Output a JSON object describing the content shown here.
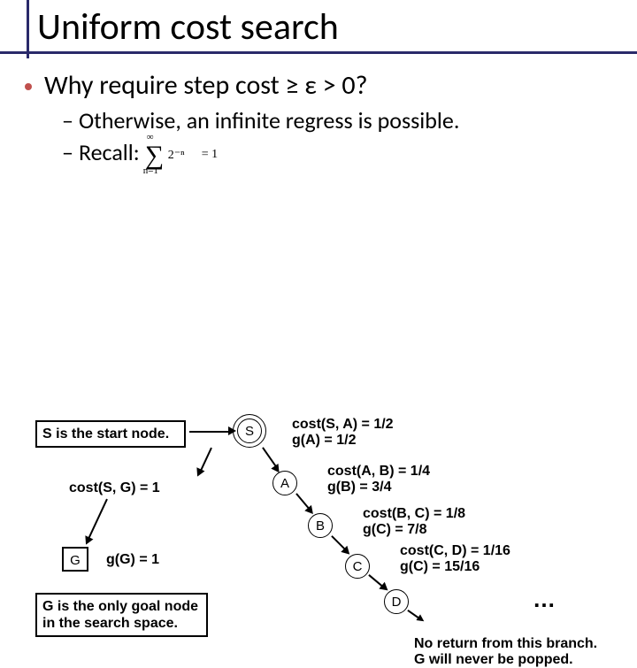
{
  "title": "Uniform cost search",
  "bullet1": "Why require step cost ≥ ε > 0?",
  "sub1": "Otherwise, an infinite regress is possible.",
  "sub2_prefix": "Recall:",
  "sigma": {
    "top": "∞",
    "bottom": "n=1",
    "term": "2⁻ⁿ",
    "rhs": "= 1"
  },
  "diagram": {
    "start_label": "S is the start node.",
    "cost_sg": "cost(S, G) = 1",
    "g_label": "g(G) = 1",
    "goal_label": "G is the only goal node in the search space.",
    "s": "S",
    "a": "A",
    "b": "B",
    "c": "C",
    "d": "D",
    "g": "G",
    "sa_cost": "cost(S, A) = 1/2",
    "ga_val": "g(A) = 1/2",
    "ab_cost": "cost(A, B) = 1/4",
    "gb_val": "g(B) = 3/4",
    "bc_cost": "cost(B, C) = 1/8",
    "gc_val": "g(C) = 7/8",
    "cd_cost": "cost(C, D) = 1/16",
    "gcd_val": "g(C) = 15/16",
    "ellipsis": "…",
    "no_return1": "No return from this branch.",
    "no_return2": "G will never be popped."
  }
}
